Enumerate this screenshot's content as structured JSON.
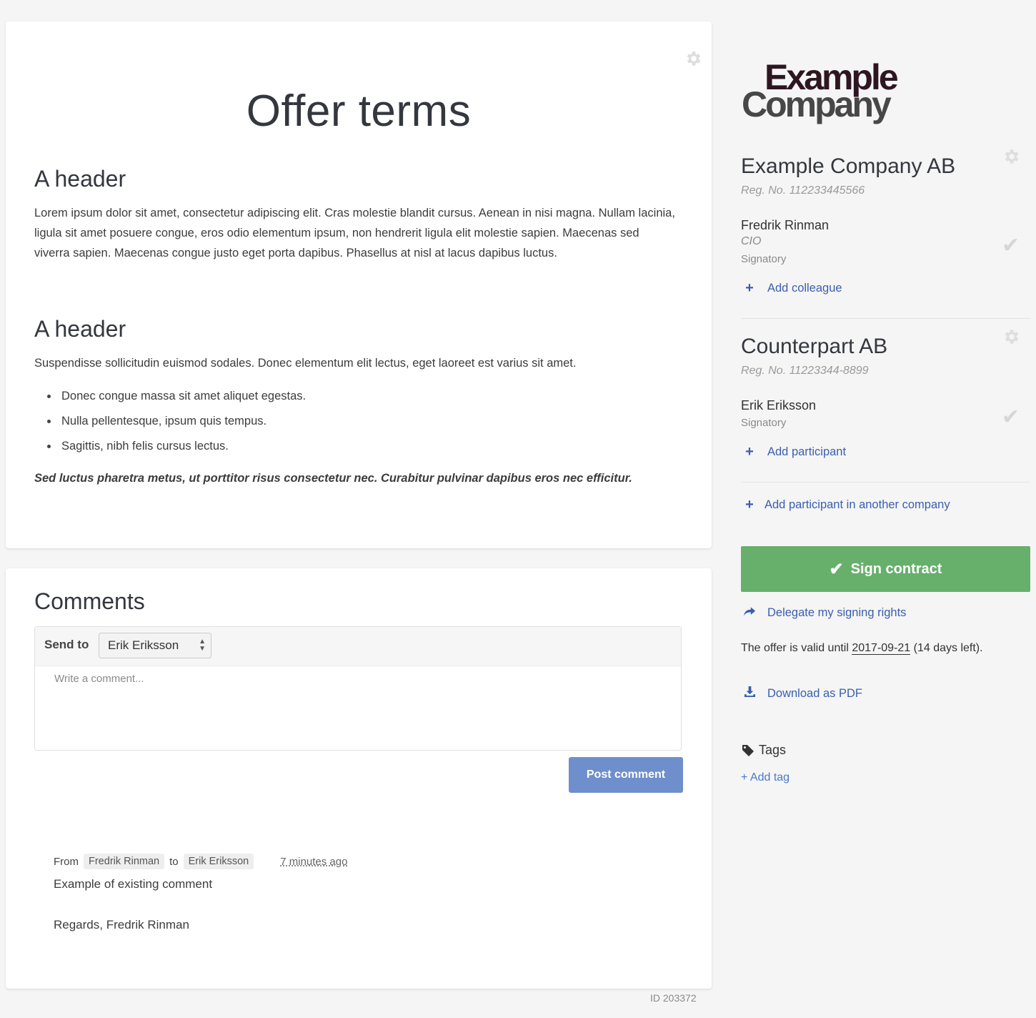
{
  "offer": {
    "title": "Offer terms",
    "sections": [
      {
        "header": "A header",
        "body": "Lorem ipsum dolor sit amet, consectetur adipiscing elit. Cras molestie blandit cursus. Aenean in nisi magna. Nullam lacinia, ligula sit amet posuere congue, eros odio elementum ipsum, non hendrerit ligula elit molestie sapien. Maecenas sed viverra sapien. Maecenas congue justo eget porta dapibus. Phasellus at nisl at lacus dapibus luctus."
      },
      {
        "header": "A header",
        "body": "Suspendisse sollicitudin euismod sodales. Donec elementum elit lectus, eget laoreet est varius sit amet.",
        "bullets": [
          "Donec congue massa sit amet aliquet egestas.",
          "Nulla pellentesque, ipsum quis tempus.",
          "Sagittis, nibh felis cursus lectus."
        ],
        "closing": "Sed luctus pharetra metus, ut porttitor risus consectetur nec. Curabitur pulvinar dapibus eros nec efficitur."
      }
    ]
  },
  "comments": {
    "title": "Comments",
    "send_to_label": "Send to",
    "send_to_value": "Erik Eriksson",
    "placeholder": "Write a comment...",
    "post_label": "Post comment",
    "existing": {
      "from_label": "From",
      "from": "Fredrik Rinman",
      "to_label": "to",
      "to": "Erik Eriksson",
      "time": "7 minutes ago",
      "line1": "Example of existing comment",
      "line2": "Regards, Fredrik Rinman"
    }
  },
  "doc_id": "ID 203372",
  "sidebar": {
    "logo_line1": "Example",
    "logo_line2": "Company",
    "party1": {
      "name": "Example Company AB",
      "reg": "Reg. No. 112233445566",
      "person": "Fredrik Rinman",
      "role": "CIO",
      "signatory": "Signatory",
      "add_label": "Add colleague"
    },
    "party2": {
      "name": "Counterpart AB",
      "reg": "Reg. No. 11223344-8899",
      "person": "Erik Eriksson",
      "signatory": "Signatory",
      "add_label": "Add participant"
    },
    "add_other_company": "Add participant in another company",
    "sign_label": "Sign contract",
    "delegate_label": "Delegate my signing rights",
    "valid_prefix": "The offer is valid until",
    "valid_date": "2017-09-21",
    "valid_suffix": "(14 days left).",
    "download_label": "Download as PDF",
    "tags_label": "Tags",
    "add_tag_label": "+ Add tag"
  },
  "colors": {
    "sign_button": "#66b06b",
    "post_button": "#6e8fcb",
    "link": "#3a5fae"
  }
}
